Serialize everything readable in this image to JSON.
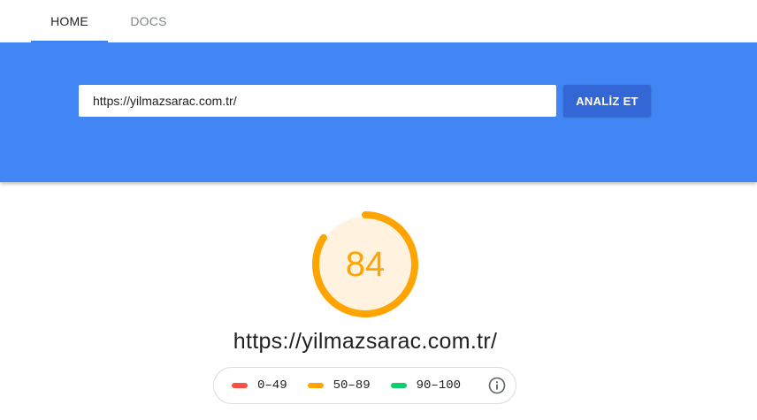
{
  "nav": {
    "tabs": [
      {
        "label": "HOME",
        "active": true
      },
      {
        "label": "DOCS",
        "active": false
      }
    ]
  },
  "hero": {
    "url_value": "https://yilmazsarac.com.tr/",
    "analyze_label": "ANALİZ ET"
  },
  "result": {
    "score": 84,
    "score_text": "84",
    "url": "https://yilmazsarac.com.tr/"
  },
  "legend": {
    "items": [
      {
        "label": "0–49",
        "color": "#ff4e42"
      },
      {
        "label": "50–89",
        "color": "#ffa400"
      },
      {
        "label": "90–100",
        "color": "#0cce6b"
      }
    ],
    "info_icon": "info-icon"
  },
  "colors": {
    "brand_blue": "#4285f4",
    "button_blue": "#3367d6",
    "score_average": "#ffa400",
    "gauge_fill": "#fff3e0"
  }
}
